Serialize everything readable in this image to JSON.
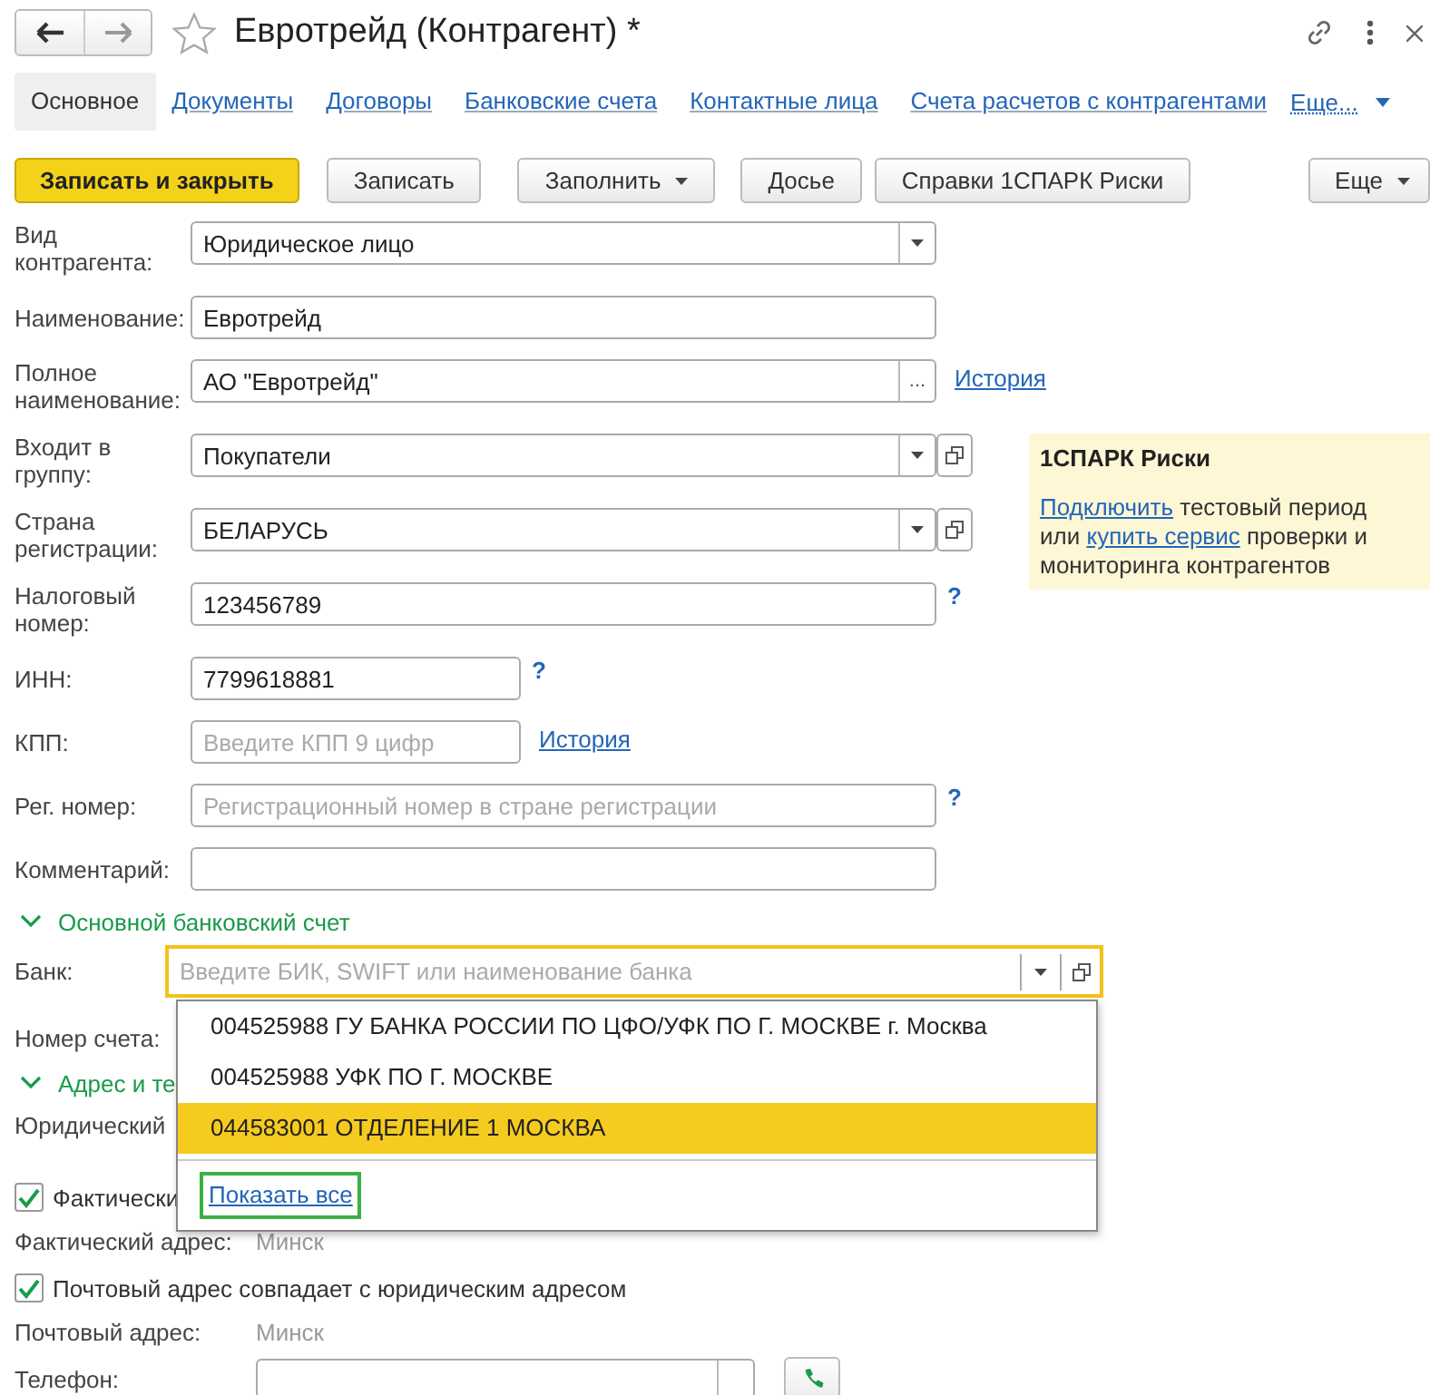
{
  "window": {
    "title": "Евротрейд (Контрагент) *"
  },
  "tabs": [
    {
      "label": "Основное",
      "selected": true
    },
    {
      "label": "Документы",
      "selected": false
    },
    {
      "label": "Договоры",
      "selected": false
    },
    {
      "label": "Банковские счета",
      "selected": false
    },
    {
      "label": "Контактные лица",
      "selected": false
    },
    {
      "label": "Счета расчетов с контрагентами",
      "selected": false
    }
  ],
  "tabs_more": "Еще...",
  "toolbar": [
    {
      "label": "Записать и закрыть",
      "kind": "primary"
    },
    {
      "label": "Записать",
      "kind": "plain"
    },
    {
      "label": "Заполнить",
      "kind": "menu"
    },
    {
      "label": "Досье",
      "kind": "plain"
    },
    {
      "label": "Справки 1СПАРК Риски",
      "kind": "plain"
    }
  ],
  "toolbar_more": "Еще",
  "fields": [
    {
      "label": "Вид контрагента:",
      "kind": "select",
      "value": "Юридическое лицо"
    },
    {
      "label": "Наименование:",
      "kind": "text",
      "value": "Евротрейд"
    },
    {
      "label": "Полное наименование:",
      "kind": "text-more",
      "value": "АО \"Евротрейд\"",
      "more": "...",
      "link": "История"
    },
    {
      "label": "Входит в группу:",
      "kind": "select-open",
      "value": "Покупатели"
    },
    {
      "label": "Страна регистрации:",
      "kind": "select-open",
      "value": "БЕЛАРУСЬ"
    },
    {
      "label": "Налоговый номер:",
      "kind": "text",
      "value": "123456789",
      "help": "?"
    },
    {
      "label": "ИНН:",
      "kind": "short-text",
      "value": "7799618881",
      "help": "?"
    },
    {
      "label": "КПП:",
      "kind": "short-text",
      "placeholder": "Введите КПП 9 цифр",
      "link": "История"
    },
    {
      "label": "Рег. номер:",
      "kind": "text",
      "placeholder": "Регистрационный номер в стране регистрации",
      "help": "?"
    },
    {
      "label": "Комментарий:",
      "kind": "text"
    }
  ],
  "spark_panel": {
    "title": "1СПАРК Риски",
    "segments": [
      {
        "kind": "link",
        "text": "Подключить"
      },
      {
        "kind": "text",
        "text": " тестовый период или "
      },
      {
        "kind": "link",
        "text": "купить сервис"
      },
      {
        "kind": "text",
        "text": " проверки и мониторинга контрагентов"
      }
    ]
  },
  "bank_section": {
    "title": "Основной банковский счет",
    "expanded": true,
    "bank": {
      "label": "Банк:",
      "placeholder": "Введите БИК, SWIFT или наименование банка",
      "focused": true
    },
    "account_label": "Номер счета:",
    "dropdown": {
      "items": [
        {
          "label": "004525988 ГУ БАНКА РОССИИ ПО ЦФО/УФК ПО Г. МОСКВЕ г. Москва",
          "selected": false
        },
        {
          "label": "004525988 УФК ПО Г. МОСКВЕ",
          "selected": false
        },
        {
          "label": "044583001 ОТДЕЛЕНИЕ 1 МОСКВА",
          "selected": true
        }
      ],
      "footer_link": "Показать все",
      "footer_focused": true
    }
  },
  "address_section": {
    "title": "Адрес и те",
    "expanded": true,
    "rows": [
      {
        "kind": "label",
        "label": "Юридический"
      },
      {
        "kind": "checkbox",
        "label": "Фактически",
        "checked": true
      },
      {
        "kind": "value",
        "label": "Фактический адрес:",
        "value": "Минск"
      },
      {
        "kind": "checkbox",
        "label": "Почтовый адрес совпадает с юридическим адресом",
        "checked": true
      },
      {
        "kind": "value",
        "label": "Почтовый адрес:",
        "value": "Минск"
      },
      {
        "kind": "phone",
        "label": "Телефон:"
      }
    ]
  }
}
